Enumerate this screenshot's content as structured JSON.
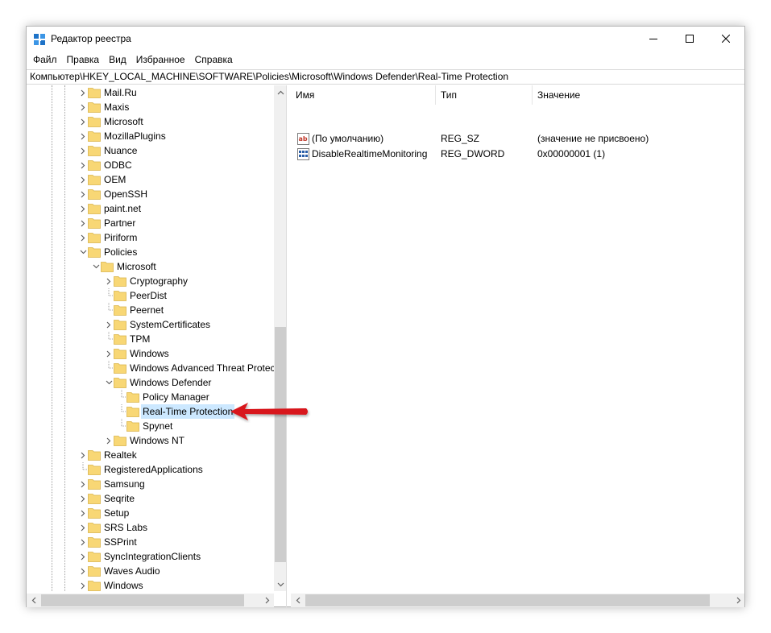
{
  "window": {
    "title": "Редактор реестра",
    "controls": {
      "minimize": "minimize",
      "maximize": "maximize",
      "close": "close"
    }
  },
  "menu": [
    "Файл",
    "Правка",
    "Вид",
    "Избранное",
    "Справка"
  ],
  "address": "Компьютер\\HKEY_LOCAL_MACHINE\\SOFTWARE\\Policies\\Microsoft\\Windows Defender\\Real-Time Protection",
  "tree": [
    {
      "label": "Mail.Ru",
      "level": 0,
      "expander": "collapsed"
    },
    {
      "label": "Maxis",
      "level": 0,
      "expander": "collapsed"
    },
    {
      "label": "Microsoft",
      "level": 0,
      "expander": "collapsed"
    },
    {
      "label": "MozillaPlugins",
      "level": 0,
      "expander": "collapsed"
    },
    {
      "label": "Nuance",
      "level": 0,
      "expander": "collapsed"
    },
    {
      "label": "ODBC",
      "level": 0,
      "expander": "collapsed"
    },
    {
      "label": "OEM",
      "level": 0,
      "expander": "collapsed"
    },
    {
      "label": "OpenSSH",
      "level": 0,
      "expander": "collapsed"
    },
    {
      "label": "paint.net",
      "level": 0,
      "expander": "collapsed"
    },
    {
      "label": "Partner",
      "level": 0,
      "expander": "collapsed"
    },
    {
      "label": "Piriform",
      "level": 0,
      "expander": "collapsed"
    },
    {
      "label": "Policies",
      "level": 0,
      "expander": "expanded"
    },
    {
      "label": "Microsoft",
      "level": 1,
      "expander": "expanded"
    },
    {
      "label": "Cryptography",
      "level": 2,
      "expander": "collapsed"
    },
    {
      "label": "PeerDist",
      "level": 2,
      "expander": "none"
    },
    {
      "label": "Peernet",
      "level": 2,
      "expander": "none"
    },
    {
      "label": "SystemCertificates",
      "level": 2,
      "expander": "collapsed"
    },
    {
      "label": "TPM",
      "level": 2,
      "expander": "none"
    },
    {
      "label": "Windows",
      "level": 2,
      "expander": "collapsed"
    },
    {
      "label": "Windows Advanced Threat Protect",
      "level": 2,
      "expander": "none"
    },
    {
      "label": "Windows Defender",
      "level": 2,
      "expander": "expanded"
    },
    {
      "label": "Policy Manager",
      "level": 3,
      "expander": "none"
    },
    {
      "label": "Real-Time Protection",
      "level": 3,
      "expander": "none",
      "selected": true
    },
    {
      "label": "Spynet",
      "level": 3,
      "expander": "none"
    },
    {
      "label": "Windows NT",
      "level": 2,
      "expander": "collapsed"
    },
    {
      "label": "Realtek",
      "level": 0,
      "expander": "collapsed"
    },
    {
      "label": "RegisteredApplications",
      "level": 0,
      "expander": "none"
    },
    {
      "label": "Samsung",
      "level": 0,
      "expander": "collapsed"
    },
    {
      "label": "Seqrite",
      "level": 0,
      "expander": "collapsed"
    },
    {
      "label": "Setup",
      "level": 0,
      "expander": "collapsed"
    },
    {
      "label": "SRS Labs",
      "level": 0,
      "expander": "collapsed"
    },
    {
      "label": "SSPrint",
      "level": 0,
      "expander": "collapsed"
    },
    {
      "label": "SyncIntegrationClients",
      "level": 0,
      "expander": "collapsed"
    },
    {
      "label": "Waves Audio",
      "level": 0,
      "expander": "collapsed"
    },
    {
      "label": "Windows",
      "level": 0,
      "expander": "collapsed"
    }
  ],
  "columns": {
    "name": "Имя",
    "type": "Тип",
    "value": "Значение"
  },
  "values": [
    {
      "icon": "string-value-icon",
      "name": "(По умолчанию)",
      "type": "REG_SZ",
      "value": "(значение не присвоено)"
    },
    {
      "icon": "dword-value-icon",
      "name": "DisableRealtimeMonitoring",
      "type": "REG_DWORD",
      "value": "0x00000001 (1)"
    }
  ],
  "colors": {
    "selection": "#cce8ff",
    "folder": "#f8d775",
    "annotation_arrow": "#d8181d"
  }
}
